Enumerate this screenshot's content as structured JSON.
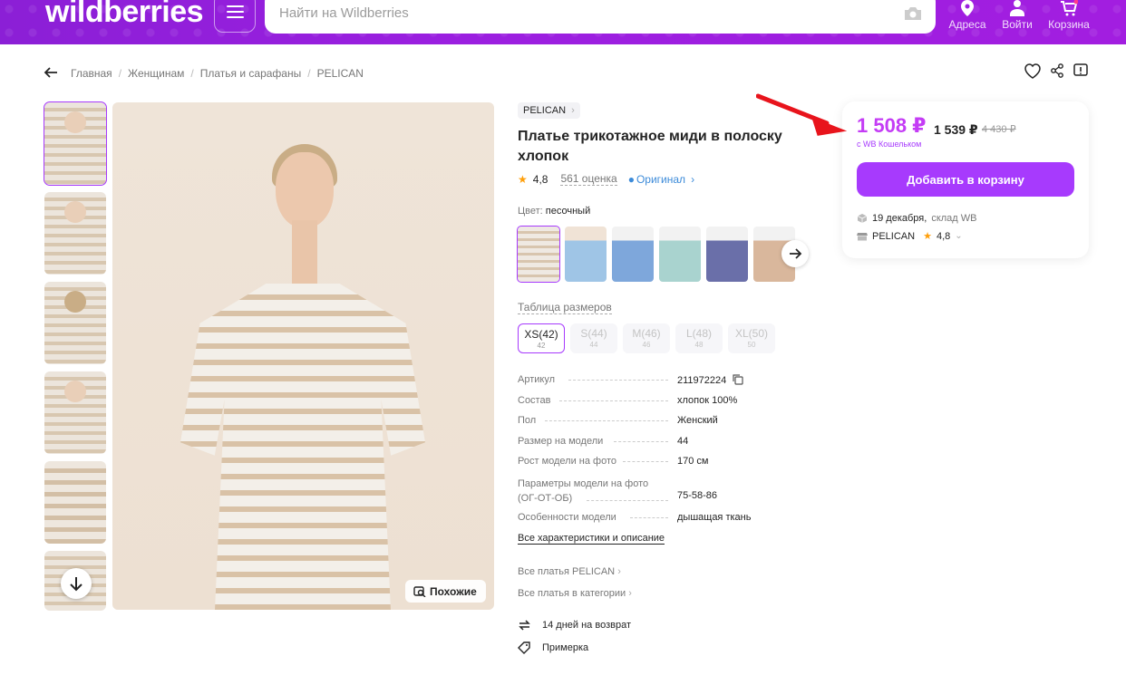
{
  "header": {
    "logo": "wildberries",
    "search_placeholder": "Найти на Wildberries",
    "addresses_label": "Адреса",
    "login_label": "Войти",
    "cart_label": "Корзина"
  },
  "breadcrumbs": [
    "Главная",
    "Женщинам",
    "Платья и сарафаны",
    "PELICAN"
  ],
  "gallery": {
    "similar_label": "Похожие"
  },
  "product": {
    "brand": "PELICAN",
    "title": "Платье трикотажное миди в полоску хлопок",
    "rating": "4,8",
    "reviews": "561 оценка",
    "original_label": "Оригинал",
    "color_label": "Цвет:",
    "color_value": "песочный",
    "size_table_label": "Таблица размеров",
    "sizes": [
      {
        "label": "XS(42)",
        "sub": "42",
        "active": true
      },
      {
        "label": "S(44)",
        "sub": "44",
        "active": false
      },
      {
        "label": "M(46)",
        "sub": "46",
        "active": false
      },
      {
        "label": "L(48)",
        "sub": "48",
        "active": false
      },
      {
        "label": "XL(50)",
        "sub": "50",
        "active": false
      }
    ],
    "specs": [
      {
        "key": "Артикул",
        "value": "211972224"
      },
      {
        "key": "Состав",
        "value": "хлопок 100%"
      },
      {
        "key": "Пол",
        "value": "Женский"
      },
      {
        "key": "Размер на модели",
        "value": "44"
      },
      {
        "key": "Рост модели на фото",
        "value": "170 см"
      },
      {
        "key": "Параметры модели на фото (ОГ-ОТ-ОБ)",
        "value": "75-58-86"
      },
      {
        "key": "Особенности модели",
        "value": "дышащая ткань"
      }
    ],
    "all_specs_link": "Все характеристики и описание",
    "all_brand_link": "Все платья PELICAN",
    "all_category_link": "Все платья в категории",
    "return_label": "14 дней на возврат",
    "fitting_label": "Примерка"
  },
  "price_card": {
    "wallet_price": "1 508 ₽",
    "price": "1 539 ₽",
    "old_price": "4 430 ₽",
    "wallet_note": "с WB Кошельком",
    "add_to_cart": "Добавить в корзину",
    "delivery_date": "19 декабря,",
    "warehouse": "склад WB",
    "seller": "PELICAN",
    "seller_rating": "4,8"
  },
  "colors": {
    "accent": "#a73afd",
    "price": "#c43cf5",
    "header": "#9b1fe0",
    "arrow": "#e8141c"
  }
}
